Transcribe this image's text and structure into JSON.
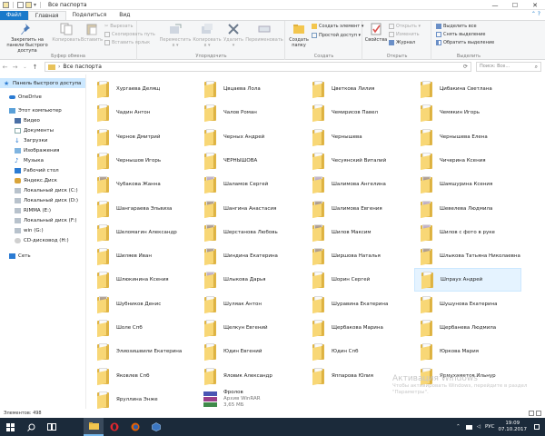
{
  "window": {
    "title": "Все паспорта",
    "minimize": "—",
    "maximize": "☐",
    "close": "✕"
  },
  "ribbon_tabs": [
    "Файл",
    "Главная",
    "Поделиться",
    "Вид"
  ],
  "ribbon": {
    "groups": {
      "clipboard": "Буфер обмена",
      "organize": "Упорядочить",
      "create": "Создать",
      "open": "Открыть",
      "select": "Выделить"
    },
    "pin": "Закрепить на панели быстрого доступа",
    "copy": "Копировать",
    "paste": "Вставить",
    "cut": "Вырезать",
    "copy_path": "Скопировать путь",
    "paste_shortcut": "Вставить ярлык",
    "move_to": "Переместить в ▾",
    "copy_to": "Копировать в ▾",
    "delete": "Удалить ▾",
    "rename": "Переименовать",
    "new_folder": "Создать папку",
    "new_item": "Создать элемент ▾",
    "easy_access": "Простой доступ ▾",
    "properties": "Свойства",
    "open": "Открыть ▾",
    "edit": "Изменить",
    "history": "Журнал",
    "select_all": "Выделить все",
    "select_none": "Снять выделение",
    "invert_selection": "Обратить выделение"
  },
  "address": {
    "path": "Все паспорта",
    "search_placeholder": "Поиск: Все..."
  },
  "nav_pane": [
    "Панель быстрого доступа",
    "OneDrive",
    "Этот компьютер",
    "Видео",
    "Документы",
    "Загрузки",
    "Изображения",
    "Музыка",
    "Рабочий стол",
    "Яндекс.Диск",
    "Локальный диск (C:)",
    "Локальный диск (D:)",
    "RIMMA (E:)",
    "Локальный диск (F:)",
    "win (G:)",
    "CD-дисковод (H:)",
    "Сеть"
  ],
  "files": {
    "col1": [
      "Хургаева Делящ",
      "Чадин Антон",
      "Чернов Дмитрий",
      "Чернышов Игорь",
      "Чубакова Жанна",
      "Шангараева Эльвиза",
      "Шеломагин Александр",
      "Шиляев Иван",
      "Шлюкинина Ксения",
      "Шубников Денис",
      "Шоле Спб",
      "Элиозишвили Екатерина",
      "Яковлев Спб",
      "Яруллина Энже"
    ],
    "col2": [
      "Цвцаева Лола",
      "Чалов Роман",
      "Черных Андрей",
      "ЧЕРНЫШОВА",
      "Шаламов Сергей",
      "Шангина Анастасия",
      "Шерстанова Любовь",
      "Шиндина Екатерина",
      "Шлыкова Дарья",
      "Шуляак Антон",
      "Щелкун Евгений",
      "Юдин Евгений",
      "Яловик Александр"
    ],
    "col3": [
      "Цветкова Лилия",
      "Чемирисов Павел",
      "Чернышева",
      "Чесуянский Виталий",
      "Шалимова Ангелина",
      "Шалимова Евгения",
      "Шилов Максим",
      "Ширшова Наталья",
      "Шорин Сергей",
      "Шуравина Екатерина",
      "Щербакова Марина",
      "Юдин Спб",
      "Яппарова Юлия"
    ],
    "col4": [
      "Цибакина Светлана",
      "Чемякин Игорь",
      "Чернышева Елена",
      "Чичерина Ксения",
      "Шамшурина Ксения",
      "Шевелева Людмила",
      "Шилов с фото в руке",
      "Шлыкова Татьяна Николаевна",
      "Шпраух Андрей",
      "Шушунова Екатерина",
      "Щербанева Людмила",
      "Юркова Мария",
      "Ярмухаметов Ильнур"
    ],
    "archive": {
      "name": "Фролов",
      "type": "Архив WinRAR",
      "size": "3,65 МБ"
    }
  },
  "watermark": {
    "title": "Активация Windows",
    "text": "Чтобы активировать Windows, перейдите в раздел \"Параметры\"."
  },
  "status": {
    "count": "Элементов: 498"
  },
  "taskbar": {
    "lang": "РУС",
    "time": "19:09",
    "date": "07.10.2017"
  },
  "colors": {
    "accent": "#1979ca",
    "selection": "#cce8ff",
    "folder": "#f8d776",
    "taskbar": "#1b2a3a"
  }
}
